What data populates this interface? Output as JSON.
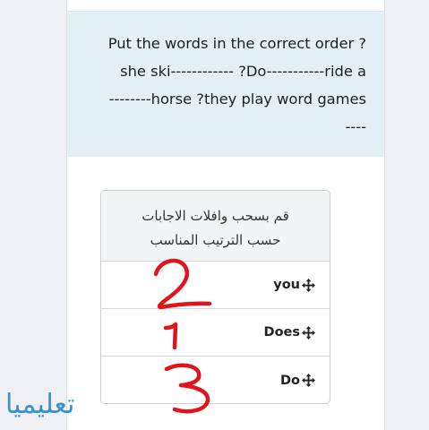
{
  "question": {
    "lines": [
      "Put the words in the correct order ?",
      "she ski------------ ?Do-----------ride a",
      "--------horse ?they play word games",
      "----"
    ]
  },
  "sortable": {
    "instruction_line1": "قم بسحب وافلات الاجابات",
    "instruction_line2": "حسب الترتيب المناسب",
    "items": [
      {
        "label": "you",
        "icon": "move-icon"
      },
      {
        "label": "Does",
        "icon": "move-icon"
      },
      {
        "label": "Do",
        "icon": "move-icon"
      }
    ]
  },
  "annotations": {
    "handwritten_numbers": [
      "2",
      "1",
      "3"
    ],
    "ink_color": "#e0151b"
  },
  "watermark": {
    "text": "تعليميا",
    "color": "#3f8fc9"
  },
  "colors": {
    "question_bg": "#e3f1f7",
    "header_bg": "#f3f4f6",
    "border": "#c9ced4"
  }
}
